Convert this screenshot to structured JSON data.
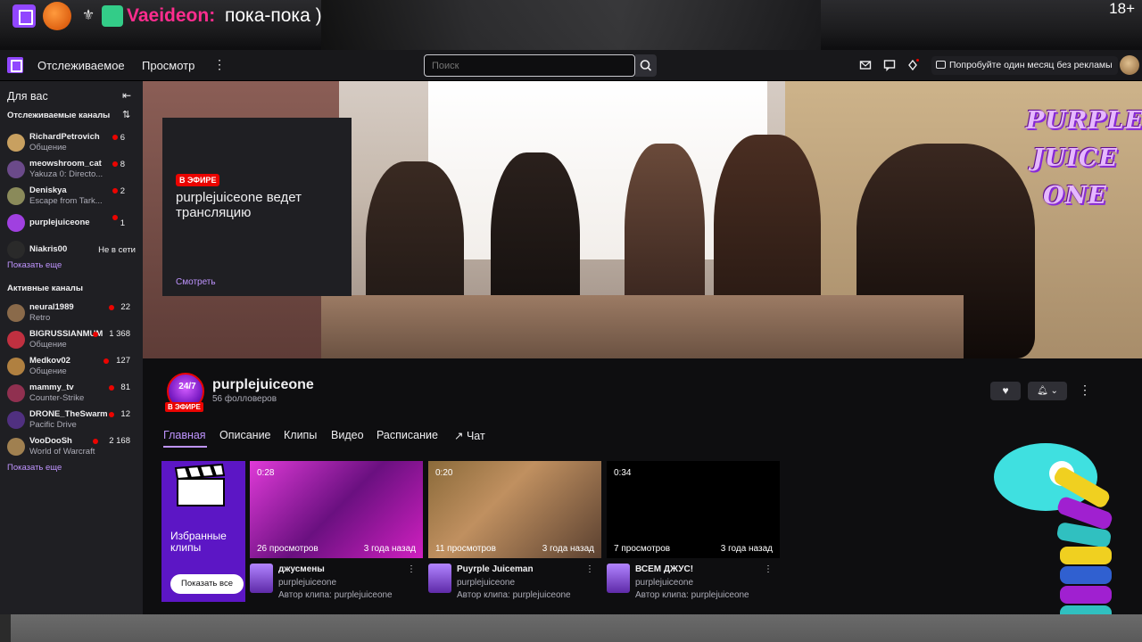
{
  "overlay": {
    "username": "Vaeideon:",
    "message": "пока-пока )",
    "age_label": "18+"
  },
  "nav": {
    "following": "Отслеживаемое",
    "browse": "Просмотр",
    "search_placeholder": "Поиск",
    "promo": "Попробуйте один месяц без рекламы"
  },
  "sidebar": {
    "title": "Для вас",
    "followed_title": "Отслеживаемые каналы",
    "followed": [
      {
        "name": "RichardPetrovich",
        "game": "Общение",
        "viewers": "6",
        "live": true,
        "avatar_color": "#c8a060"
      },
      {
        "name": "meowshroom_cat",
        "game": "Yakuza 0: Directo...",
        "viewers": "8",
        "live": true,
        "avatar_color": "#6b4a8a"
      },
      {
        "name": "Deniskya",
        "game": "Escape from Tark...",
        "viewers": "2",
        "live": true,
        "avatar_color": "#8a8a5a"
      },
      {
        "name": "purplejuiceone",
        "game": "",
        "viewers": "1",
        "live": true,
        "avatar_color": "#a040e0"
      },
      {
        "name": "Niakris00",
        "game": "",
        "viewers": "Не в сети",
        "live": false,
        "avatar_color": "#2a2a2a"
      }
    ],
    "show_more_1": "Показать еще",
    "active_title": "Активные каналы",
    "active": [
      {
        "name": "neural1989",
        "game": "Retro",
        "viewers": "22",
        "avatar_color": "#8a6a4a"
      },
      {
        "name": "BIGRUSSIANMUM",
        "game": "Общение",
        "viewers": "1 368",
        "avatar_color": "#c03040"
      },
      {
        "name": "Medkov02",
        "game": "Общение",
        "viewers": "127",
        "avatar_color": "#b08040"
      },
      {
        "name": "mammy_tv",
        "game": "Counter-Strike",
        "viewers": "81",
        "avatar_color": "#903050"
      },
      {
        "name": "DRONE_TheSwarm",
        "game": "Pacific Drive",
        "viewers": "12",
        "avatar_color": "#503080"
      },
      {
        "name": "VooDooSh",
        "game": "World of Warcraft",
        "viewers": "2 168",
        "avatar_color": "#a08050"
      }
    ],
    "show_more_2": "Показать еще"
  },
  "video": {
    "brand": "PURPLE JUICE ONE",
    "live_badge": "В ЭФИРЕ",
    "live_title": "purplejuiceone ведет трансляцию",
    "watch": "Смотреть"
  },
  "channel": {
    "avatar_text": "24/7",
    "live_badge": "В ЭФИРЕ",
    "name": "purplejuiceone",
    "followers": "56 фолловеров",
    "tabs": [
      "Главная",
      "Описание",
      "Клипы",
      "Видео",
      "Расписание",
      "Чат"
    ],
    "featured_title": "Избранные клипы",
    "show_all": "Показать все",
    "clips": [
      {
        "duration": "0:28",
        "views": "26 просмотров",
        "age": "3 года назад",
        "title": "джусмены",
        "channel": "purplejuiceone",
        "author": "Автор клипа: purplejuiceone"
      },
      {
        "duration": "0:20",
        "views": "11 просмотров",
        "age": "3 года назад",
        "title": "Puyrple Juiceman",
        "channel": "purplejuiceone",
        "author": "Автор клипа: purplejuiceone"
      },
      {
        "duration": "0:34",
        "views": "7 просмотров",
        "age": "3 года назад",
        "title": "ВСЕМ ДЖУС!",
        "channel": "purplejuiceone",
        "author": "Автор клипа: purplejuiceone"
      }
    ]
  },
  "colors": {
    "accent": "#bf94ff",
    "twitch_purple": "#9147ff",
    "live_red": "#eb0400"
  }
}
